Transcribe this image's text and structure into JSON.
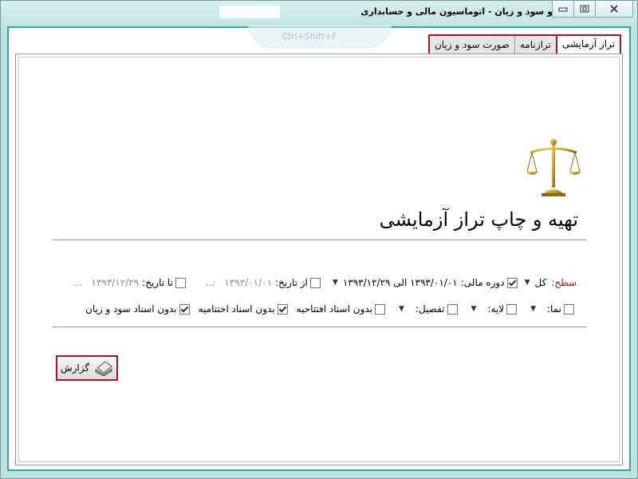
{
  "window": {
    "title": "گزارشات تراز و سود و زیان - اتوماسیون مالی و حسابداری",
    "ghost_shortcut": "Ctrl+Shift+F"
  },
  "tabs": [
    {
      "label": "تراز آزمایشی",
      "active": true
    },
    {
      "label": "ترازنامه",
      "active": false
    },
    {
      "label": "صورت سود و زیان",
      "active": false
    }
  ],
  "page": {
    "title": "تهیه و چاپ تراز آزمایشی",
    "icon": "scale-icon"
  },
  "filters_row1": {
    "level_label": "سطح:",
    "level_value": "کل",
    "fiscal_period_label": "دوره مالی:",
    "fiscal_period_checked": true,
    "fiscal_period_value": "۱۳۹۳/۰۱/۰۱ الی ۱۳۹۳/۱۲/۲۹",
    "from_date_label": "از تاریخ:",
    "from_date_checked": false,
    "from_date_value": "۱۳۹۳/۰۱/۰۱",
    "to_date_label": "تا تاریخ:",
    "to_date_checked": false,
    "to_date_value": "۱۳۹۳/۱۲/۲۹",
    "ellipsis": "..."
  },
  "filters_row2": {
    "nama_label": "نما:",
    "nama_checked": false,
    "layer_label": "لایه:",
    "layer_checked": false,
    "detail_label": "تفصیل:",
    "detail_checked": false,
    "no_opening_label": "بدون اسناد افتتاحیه",
    "no_opening_checked": false,
    "no_closing_label": "بدون اسناد اختتامیه",
    "no_closing_checked": true,
    "no_pl_label": "بدون اسناد سود و زیان",
    "no_pl_checked": true
  },
  "actions": {
    "report_label": "گزارش"
  },
  "colors": {
    "accent_red": "#b0141c",
    "frame_teal": "#2ea89d"
  }
}
